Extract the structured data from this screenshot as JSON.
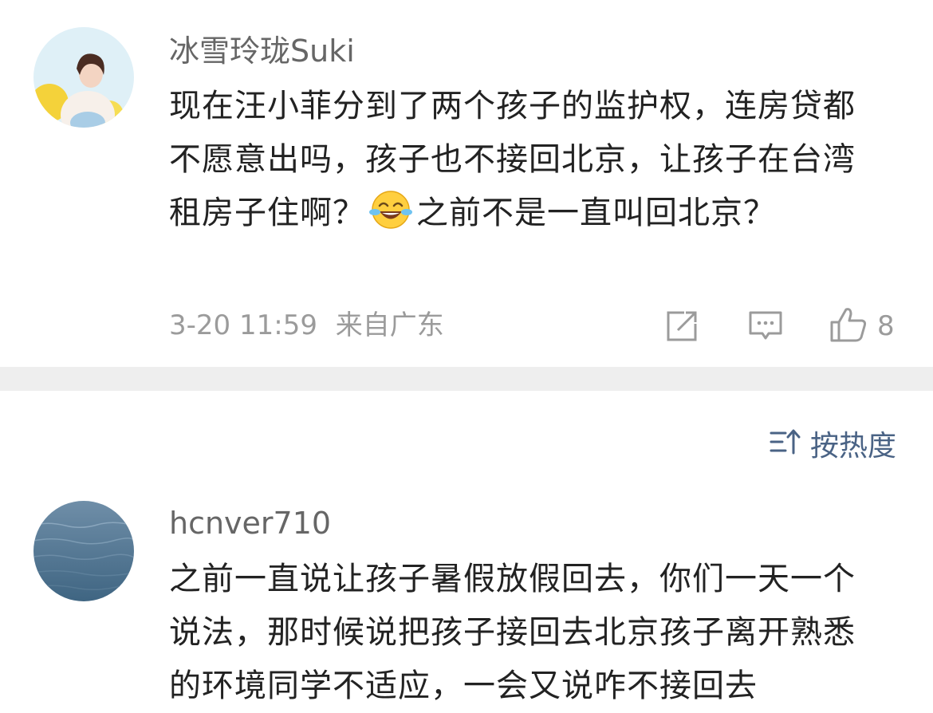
{
  "comments": [
    {
      "username": "冰雪玲珑Suki",
      "text_part1": "现在汪小菲分到了两个孩子的监护权，连房贷都不愿意出吗，孩子也不接回北京，让孩子在台湾租房子住啊？",
      "emoji": "laughing-tears-emoji",
      "text_part2": "之前不是一直叫回北京？",
      "timestamp": "3-20 11:59",
      "location": "来自广东",
      "like_count": "8"
    },
    {
      "username": "hcnver710",
      "text_part1": "之前一直说让孩子暑假放假回去，你们一天一个说法，那时候说把孩子接回去北京孩子离开熟悉的环境同学不适应，一会又说咋不接回去"
    }
  ],
  "sort": {
    "label": "按热度",
    "icon": "sort-icon"
  },
  "icons": {
    "share": "share-icon",
    "comment": "comment-icon",
    "like": "thumbs-up-icon"
  },
  "colors": {
    "username": "#666666",
    "body_text": "#222222",
    "meta": "#9b9b9b",
    "sort_accent": "#4a6385",
    "separator": "#eeeeee"
  }
}
